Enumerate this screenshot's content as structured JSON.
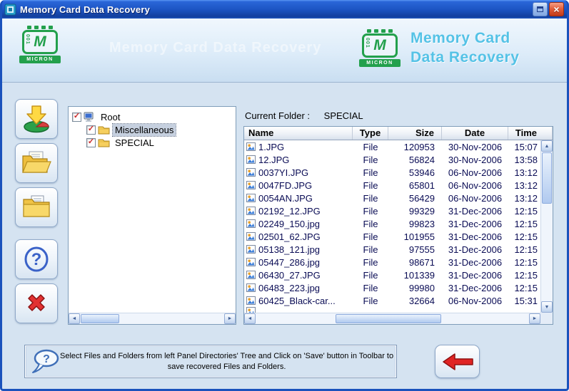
{
  "window": {
    "title": "Memory Card Data Recovery"
  },
  "icons": {
    "close": "×",
    "check": "✓",
    "scroll_left": "◄",
    "scroll_right": "►",
    "scroll_up": "▲",
    "scroll_down": "▼",
    "question_mark": "?"
  },
  "banner": {
    "watermark": "Memory Card Data Recovery",
    "product_line1": "Memory Card",
    "product_line2": "Data Recovery",
    "logo": {
      "digits": "001",
      "letter": "M",
      "name": "MICRON"
    }
  },
  "toolbar": {
    "buttons": [
      "save",
      "open-folder",
      "recover-folder",
      "help",
      "exit"
    ]
  },
  "tree": {
    "items": [
      {
        "label": "Root",
        "level": 0,
        "checked": true,
        "selected": false
      },
      {
        "label": "Miscellaneous",
        "level": 1,
        "checked": true,
        "selected": true
      },
      {
        "label": "SPECIAL",
        "level": 1,
        "checked": true,
        "selected": false
      }
    ]
  },
  "file_panel": {
    "current_folder_label": "Current Folder :",
    "current_folder": "SPECIAL",
    "columns": [
      "Name",
      "Type",
      "Size",
      "Date",
      "Time"
    ],
    "rows": [
      {
        "name": "1.JPG",
        "type": "File",
        "size": "120953",
        "date": "30-Nov-2006",
        "time": "15:07"
      },
      {
        "name": "12.JPG",
        "type": "File",
        "size": "56824",
        "date": "30-Nov-2006",
        "time": "13:58"
      },
      {
        "name": "0037YI.JPG",
        "type": "File",
        "size": "53946",
        "date": "06-Nov-2006",
        "time": "13:12"
      },
      {
        "name": "0047FD.JPG",
        "type": "File",
        "size": "65801",
        "date": "06-Nov-2006",
        "time": "13:12"
      },
      {
        "name": "0054AN.JPG",
        "type": "File",
        "size": "56429",
        "date": "06-Nov-2006",
        "time": "13:12"
      },
      {
        "name": "02192_12.JPG",
        "type": "File",
        "size": "99329",
        "date": "31-Dec-2006",
        "time": "12:15"
      },
      {
        "name": "02249_150.jpg",
        "type": "File",
        "size": "99823",
        "date": "31-Dec-2006",
        "time": "12:15"
      },
      {
        "name": "02501_62.JPG",
        "type": "File",
        "size": "101955",
        "date": "31-Dec-2006",
        "time": "12:15"
      },
      {
        "name": "05138_121.jpg",
        "type": "File",
        "size": "97555",
        "date": "31-Dec-2006",
        "time": "12:15"
      },
      {
        "name": "05447_286.jpg",
        "type": "File",
        "size": "98671",
        "date": "31-Dec-2006",
        "time": "12:15"
      },
      {
        "name": "06430_27.JPG",
        "type": "File",
        "size": "101339",
        "date": "31-Dec-2006",
        "time": "12:15"
      },
      {
        "name": "06483_223.jpg",
        "type": "File",
        "size": "99980",
        "date": "31-Dec-2006",
        "time": "12:15"
      },
      {
        "name": "60425_Black-car...",
        "type": "File",
        "size": "32664",
        "date": "06-Nov-2006",
        "time": "15:31"
      }
    ]
  },
  "footer": {
    "instruction_line1": "Select Files and Folders from left Panel Directories' Tree and Click on 'Save' button in Toolbar to",
    "instruction_line2": "save recovered Files and Folders."
  }
}
